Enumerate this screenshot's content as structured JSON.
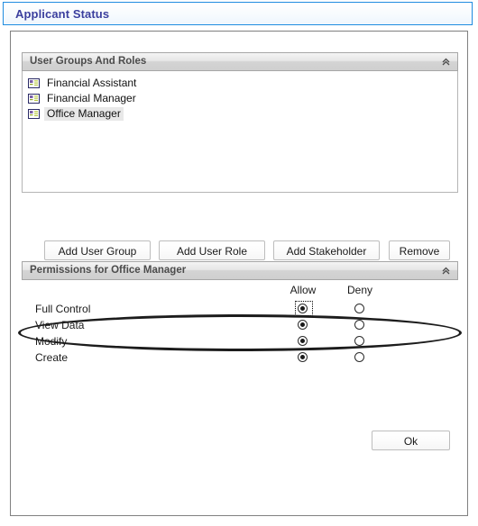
{
  "window": {
    "title": "Applicant Status",
    "title_color": "#3b3f9e",
    "accent_border": "#1f8ce0"
  },
  "user_groups_panel": {
    "header": "User Groups And Roles",
    "collapse_icon": "chevron-double-up-icon",
    "items": [
      {
        "label": "Financial Assistant",
        "icon": "id-card-icon",
        "selected": false
      },
      {
        "label": "Financial Manager",
        "icon": "id-card-icon",
        "selected": false
      },
      {
        "label": "Office Manager",
        "icon": "id-card-icon",
        "selected": true
      }
    ]
  },
  "buttons": {
    "add_user_group": "Add User Group",
    "add_user_role": "Add User Role",
    "add_stakeholder": "Add Stakeholder",
    "remove": "Remove",
    "ok": "Ok"
  },
  "permissions_panel": {
    "header": "Permissions for Office Manager",
    "collapse_icon": "chevron-double-up-icon",
    "columns": {
      "allow": "Allow",
      "deny": "Deny"
    },
    "rows": [
      {
        "label": "Full Control",
        "allow": true,
        "deny": false,
        "focused": true
      },
      {
        "label": "View Data",
        "allow": true,
        "deny": false,
        "focused": false
      },
      {
        "label": "Modify",
        "allow": true,
        "deny": false,
        "focused": false
      },
      {
        "label": "Create",
        "allow": true,
        "deny": false,
        "focused": false
      }
    ]
  },
  "annotation": {
    "shape": "ellipse",
    "color": "#1c1c1c",
    "targets": "Full Control permission row"
  }
}
